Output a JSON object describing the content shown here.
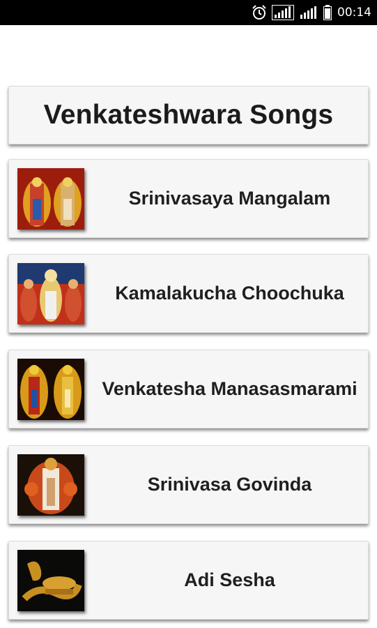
{
  "status_bar": {
    "time": "00:14",
    "icons": [
      "alarm-icon",
      "signal-icon",
      "signal-icon",
      "battery-icon"
    ]
  },
  "header": {
    "title": "Venkateshwara Songs"
  },
  "songs": [
    {
      "label": "Srinivasaya Mangalam",
      "icon": "deity-image"
    },
    {
      "label": "Kamalakucha Choochuka",
      "icon": "deity-image"
    },
    {
      "label": "Venkatesha Manasasmarami",
      "icon": "deity-image"
    },
    {
      "label": "Srinivasa Govinda",
      "icon": "deity-image"
    },
    {
      "label": "Adi Sesha",
      "icon": "serpent-image"
    }
  ],
  "colors": {
    "card_background": "#f6f6f6",
    "text": "#1f1f1f",
    "status_bar": "#000000"
  }
}
